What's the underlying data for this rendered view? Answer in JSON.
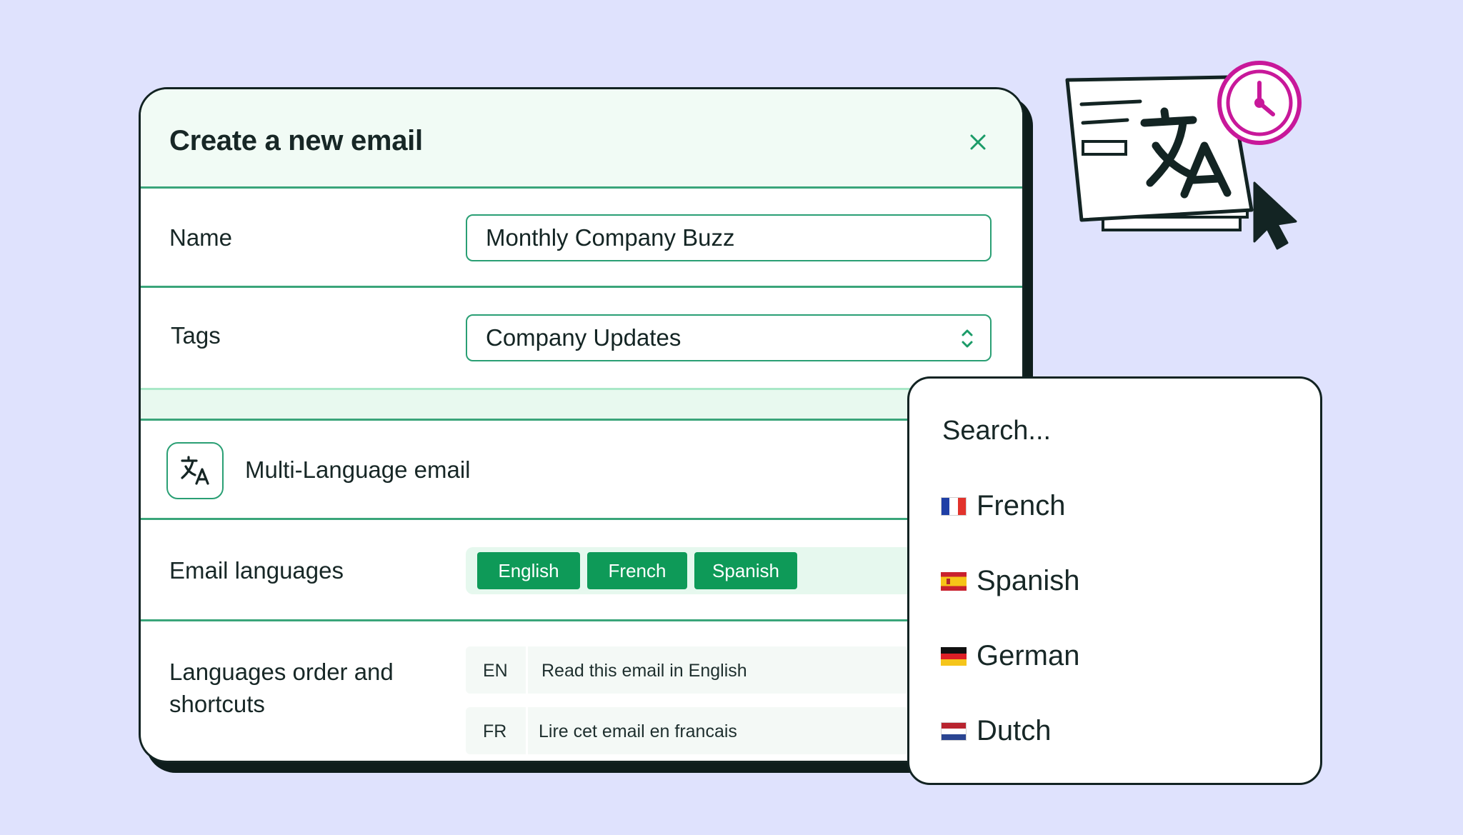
{
  "modal": {
    "title": "Create a new email",
    "close_icon": "close-icon",
    "name": {
      "label": "Name",
      "value": "Monthly Company Buzz"
    },
    "tags": {
      "label": "Tags",
      "value": "Company Updates"
    },
    "multi_language": {
      "label": "Multi-Language email",
      "icon": "translate-icon"
    },
    "email_languages": {
      "label": "Email languages",
      "chips": [
        "English",
        "French",
        "Spanish"
      ]
    },
    "languages_order": {
      "label_line1": "Languages order and",
      "label_line2": "shortcuts",
      "rows": [
        {
          "code": "EN",
          "text": "Read this email in English"
        },
        {
          "code": "FR",
          "text": "Lire cet email en  francais"
        }
      ]
    }
  },
  "dropdown": {
    "search_placeholder": "Search...",
    "items": [
      {
        "label": "French",
        "flag": "france-flag-icon"
      },
      {
        "label": "Spanish",
        "flag": "spain-flag-icon"
      },
      {
        "label": "German",
        "flag": "germany-flag-icon"
      },
      {
        "label": "Dutch",
        "flag": "netherlands-flag-icon"
      }
    ]
  },
  "colors": {
    "background": "#dfe2fd",
    "accent": "#0e9a58",
    "border": "#3aa57a",
    "magenta": "#c8189a"
  }
}
